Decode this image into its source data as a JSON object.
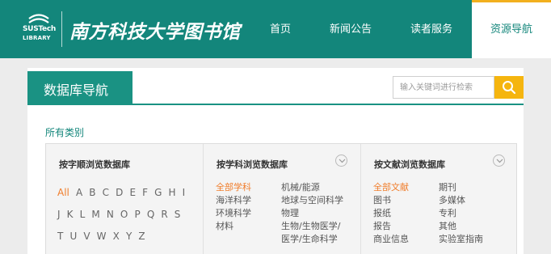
{
  "header": {
    "logo_line1": "SUSTech",
    "logo_line2": "LIBRARY",
    "library_name": "南方科技大学图书馆",
    "nav": [
      "首页",
      "新闻公告",
      "读者服务",
      "资源导航"
    ]
  },
  "panel": {
    "title": "数据库导航",
    "search_placeholder": "输入关键词进行检索",
    "all_categories": "所有类别"
  },
  "by_letter": {
    "title": "按字顺浏览数据库",
    "letters": [
      "All",
      "A",
      "B",
      "C",
      "D",
      "E",
      "F",
      "G",
      "H",
      "I",
      "J",
      "K",
      "L",
      "M",
      "N",
      "O",
      "P",
      "Q",
      "R",
      "S",
      "T",
      "U",
      "V",
      "W",
      "X",
      "Y",
      "Z"
    ]
  },
  "by_subject": {
    "title": "按学科浏览数据库",
    "items": [
      "全部学科",
      "机械/能源",
      "海洋科学",
      "地球与空间科学",
      "环境科学",
      "物理",
      "材料",
      "生物/生物医学/",
      "医学/生命科学"
    ]
  },
  "by_type": {
    "title": "按文献浏览数据库",
    "items": [
      "全部文献",
      "期刊",
      "图书",
      "多媒体",
      "报纸",
      "专利",
      "报告",
      "其他",
      "商业信息",
      "实验室指南"
    ]
  },
  "colors": {
    "brand_teal": "#13867b",
    "accent_orange": "#f07d2b",
    "search_yellow": "#f5b50f"
  }
}
